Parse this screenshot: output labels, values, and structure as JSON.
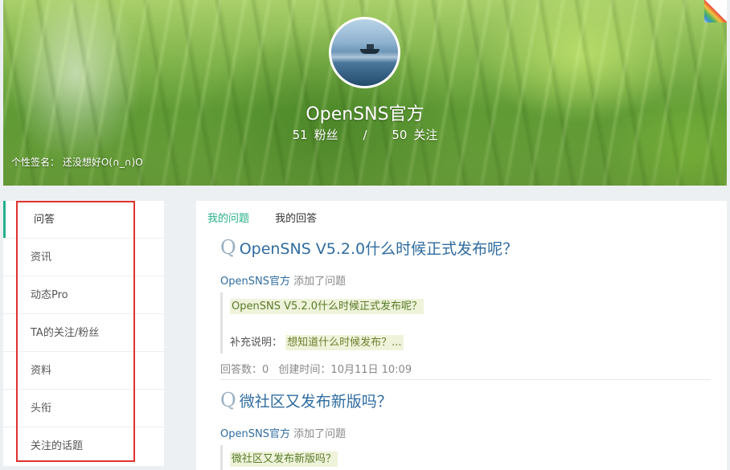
{
  "profile": {
    "nickname": "OpenSNS官方",
    "fans_count": "51",
    "fans_label": "粉丝",
    "separator": "/",
    "follow_count": "50",
    "follow_label": "关注",
    "signature": "个性签名： 还没想好O(∩_∩)O"
  },
  "sidebar": {
    "items": [
      {
        "label": "问答"
      },
      {
        "label": "资讯"
      },
      {
        "label": "动态Pro"
      },
      {
        "label": "TA的关注/粉丝"
      },
      {
        "label": "资料"
      },
      {
        "label": "头衔"
      },
      {
        "label": "关注的话题"
      }
    ]
  },
  "main": {
    "tabs": [
      {
        "label": "我的问题"
      },
      {
        "label": "我的回答"
      }
    ],
    "questions": [
      {
        "q_mark": "Q",
        "title": "OpenSNS V5.2.0什么时候正式发布呢？",
        "author": "OpenSNS官方",
        "action": "添加了问题",
        "quote": "OpenSNS V5.2.0什么时候正式发布呢？",
        "note_label": "补充说明：",
        "note_text": "想知道什么时候发布？...",
        "answers": "回答数：0",
        "created": "创建时间：10月11日 10:09"
      },
      {
        "q_mark": "Q",
        "title": "微社区又发布新版吗？",
        "author": "OpenSNS官方",
        "action": "添加了问题",
        "quote": "微社区又发布新版吗？"
      }
    ]
  },
  "colors": {
    "accent_green": "#25b089",
    "link_blue": "#2f6c9f",
    "highlight_border": "#e0312f",
    "quote_bg": "#eef3da"
  },
  "icons": {
    "corner": "corner-fold-icon"
  }
}
